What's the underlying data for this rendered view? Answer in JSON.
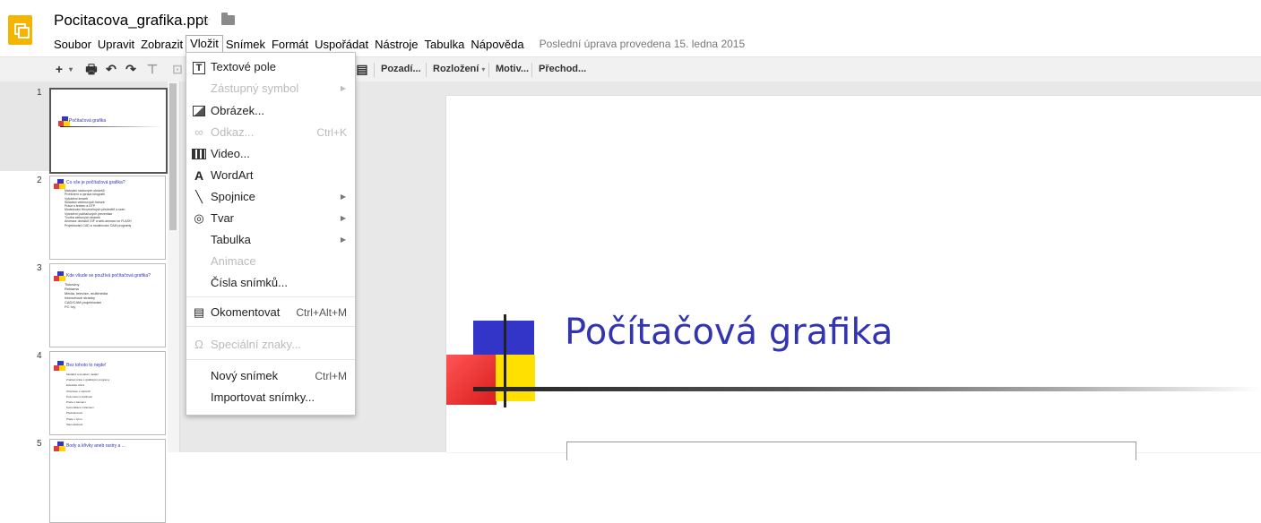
{
  "header": {
    "doc_title": "Pocitacova_grafika.ppt",
    "last_edit": "Poslední úprava provedena 15. ledna 2015"
  },
  "menubar": [
    "Soubor",
    "Upravit",
    "Zobrazit",
    "Vložit",
    "Snímek",
    "Formát",
    "Uspořádat",
    "Nástroje",
    "Tabulka",
    "Nápověda"
  ],
  "toolbar": {
    "background": "Pozadí...",
    "layout": "Rozložení",
    "theme": "Motiv...",
    "transition": "Přechod..."
  },
  "insert_menu": [
    {
      "label": "Textové pole",
      "icon": "text-box-icon",
      "disabled": false
    },
    {
      "label": "Zástupný symbol",
      "icon": "",
      "disabled": true,
      "submenu": true
    },
    {
      "label": "Obrázek...",
      "icon": "image-icon",
      "disabled": false
    },
    {
      "label": "Odkaz...",
      "icon": "link-icon",
      "disabled": true,
      "shortcut": "Ctrl+K"
    },
    {
      "label": "Video...",
      "icon": "video-icon",
      "disabled": false
    },
    {
      "label": "WordArt",
      "icon": "wordart-icon",
      "disabled": false
    },
    {
      "label": "Spojnice",
      "icon": "line-icon",
      "disabled": false,
      "submenu": true
    },
    {
      "label": "Tvar",
      "icon": "shape-icon",
      "disabled": false,
      "submenu": true
    },
    {
      "label": "Tabulka",
      "icon": "",
      "disabled": false,
      "submenu": true
    },
    {
      "label": "Animace",
      "icon": "",
      "disabled": true
    },
    {
      "label": "Čísla snímků...",
      "icon": "",
      "disabled": false
    },
    {
      "label": "Okomentovat",
      "icon": "comment-icon",
      "disabled": false,
      "shortcut": "Ctrl+Alt+M"
    },
    {
      "label": "Speciální znaky...",
      "icon": "omega-icon",
      "disabled": true
    },
    {
      "label": "Nový snímek",
      "icon": "",
      "disabled": false,
      "shortcut": "Ctrl+M"
    },
    {
      "label": "Importovat snímky...",
      "icon": "",
      "disabled": false
    }
  ],
  "slides": [
    {
      "num": "1",
      "title": "Počítačová grafika",
      "bullets": []
    },
    {
      "num": "2",
      "title": "Co vše je počítačová grafika?",
      "bullets": [
        "Malování rastrových obrázků",
        "Prohlížení a úprava fotografií",
        "Vytváření kreseb",
        "Skládání vektorových kreseb",
        "Práce s textem a DTP",
        "Modelování třírozměrných předmětů a scén",
        "Vytváření počítačových prezentací",
        "Tvorba webových stránek",
        "Animace obrázků GIF a web-animací ve FLASH",
        "Projektování CAD a modelování CAM programy"
      ]
    },
    {
      "num": "3",
      "title": "Kde všude se používá počítačová grafika?",
      "bullets": [
        "Tiskoviny",
        "Reklama",
        "Média, televize, multimédia",
        "Internetové stránky",
        "CAD/CAM projektování",
        "PC hry"
      ]
    },
    {
      "num": "4",
      "title": "Bez tohoto to nejde!",
      "bullets": [
        "Mediální a kreativní nadání",
        "Znalost práce s grafickými programy",
        "Estetické cítění",
        "Orientace v oborech",
        "Pozornost a trpělivost",
        "Práce s barvami",
        "Komunikace s klientem",
        "Představivost",
        "Práce v týmu",
        "Samostatnost"
      ]
    },
    {
      "num": "5",
      "title": "Body a křivky aneb rastry a ...",
      "bullets": []
    }
  ],
  "main_slide": {
    "title": "Počítačová grafika"
  },
  "colors": {
    "accent_yellow": "#f4b400",
    "title_blue": "#3334b0",
    "logo_blue": "#3235c7",
    "logo_red": "#e83a3a",
    "logo_yellow": "#ffe000"
  }
}
